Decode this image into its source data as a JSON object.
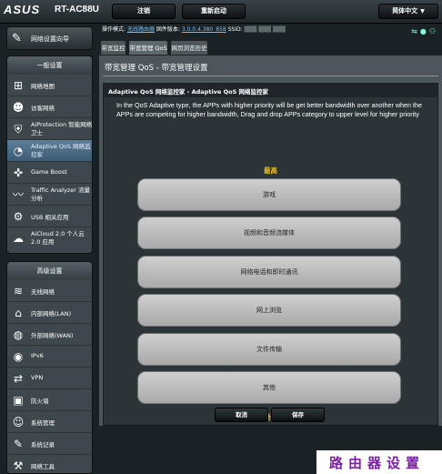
{
  "header": {
    "brand": "ASUS",
    "model": "RT-AC88U",
    "logout_label": "注销",
    "reboot_label": "重新启动",
    "language_label": "简体中文"
  },
  "status": {
    "mode_label": "操作模式:",
    "mode_value": "无线路由器",
    "firmware_label": "固件版本:",
    "firmware_value": "3.0.0.4.380_858",
    "ssid_label": "SSID:",
    "ssid_value": "(blurred)"
  },
  "sidebar": {
    "quick_setup": "网络设置向导",
    "general_header": "一般设置",
    "general_items": [
      {
        "label": "网络地图",
        "icon": "map-icon"
      },
      {
        "label": "访客网络",
        "icon": "guest-icon"
      },
      {
        "label": "AiProtection 智能网络卫士",
        "icon": "shield-icon"
      },
      {
        "label": "Adaptive QoS 网络监控家",
        "icon": "qos-icon"
      },
      {
        "label": "Game Boost",
        "icon": "gamepad-icon"
      },
      {
        "label": "Traffic Analyzer 流量分析",
        "icon": "analyzer-icon"
      },
      {
        "label": "USB 相关应用",
        "icon": "usb-icon"
      },
      {
        "label": "AiCloud 2.0 个人云 2.0 应用",
        "icon": "cloud-icon"
      }
    ],
    "advanced_header": "高级设置",
    "advanced_items": [
      {
        "label": "无线网络",
        "icon": "wifi-icon"
      },
      {
        "label": "内部网络(LAN)",
        "icon": "lan-icon"
      },
      {
        "label": "外部网络(WAN)",
        "icon": "wan-icon"
      },
      {
        "label": "IPv6",
        "icon": "ipv6-icon"
      },
      {
        "label": "VPN",
        "icon": "vpn-icon"
      },
      {
        "label": "防火墙",
        "icon": "firewall-icon"
      },
      {
        "label": "系统管理",
        "icon": "admin-icon"
      },
      {
        "label": "系统记录",
        "icon": "log-icon"
      },
      {
        "label": "网络工具",
        "icon": "tools-icon"
      }
    ]
  },
  "tabs": [
    {
      "label": "带宽监控"
    },
    {
      "label": "带宽管理 QoS"
    },
    {
      "label": "网页浏览历史"
    }
  ],
  "panel": {
    "title": "带宽管理 QoS - 带宽管理设置",
    "inner_title": "Adaptive QoS 网络监控家 - Adaptive QoS 网络监控家",
    "description": "In the QoS Adaptive type, the APPs with higher priority will be get better bandwidth over another when the APPs are competing for higher bandwidth, Drag and drop APPs category to upper level for higher priority",
    "high_label": "最高",
    "low_label": "最低",
    "priorities": [
      {
        "label": "游戏"
      },
      {
        "label": "视频和音频流媒体"
      },
      {
        "label": "网络电话和即时通讯"
      },
      {
        "label": "网上浏览"
      },
      {
        "label": "文件传输"
      },
      {
        "label": "其他"
      }
    ],
    "cancel_label": "取消",
    "save_label": "保存"
  },
  "watermark": "路由器设置"
}
